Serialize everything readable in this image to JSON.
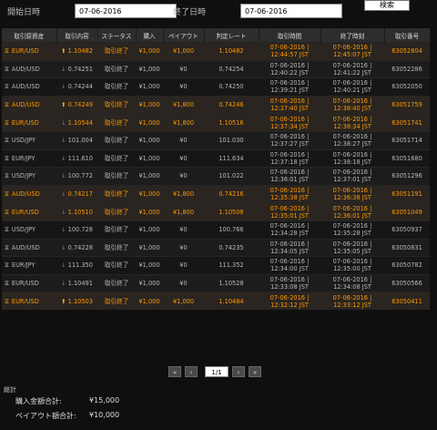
{
  "filter": {
    "start_label": "開始日時",
    "start_value": "07-06-2016",
    "end_label": "終了日時",
    "end_value": "07-06-2016",
    "search_label": "検索"
  },
  "table": {
    "headers": [
      "取引原資産",
      "取引内容",
      "ステータス",
      "購入",
      "ペイアウト",
      "判定レート",
      "取引時間",
      "終了時刻",
      "取引番号"
    ],
    "rows": [
      {
        "asset": "EUR/USD",
        "dir": "up",
        "rate": "1.10482",
        "status": "取引終了",
        "purchase": "¥1,000",
        "payout": "¥1,000",
        "judge": "1.10482",
        "time1": "07-06-2016 |",
        "time2": "12:44:57 JST",
        "end1": "07-06-2016 |",
        "end2": "12:45:07 JST",
        "id": "63052804",
        "result": "win"
      },
      {
        "asset": "AUD/USD",
        "dir": "down",
        "rate": "0.74251",
        "status": "取引終了",
        "purchase": "¥1,000",
        "payout": "¥0",
        "judge": "0.74254",
        "time1": "07-06-2016 |",
        "time2": "12:40:22 JST",
        "end1": "07-06-2016 |",
        "end2": "12:41:22 JST",
        "id": "63052286",
        "result": "lose"
      },
      {
        "asset": "AUD/USD",
        "dir": "down",
        "rate": "0.74244",
        "status": "取引終了",
        "purchase": "¥1,000",
        "payout": "¥0",
        "judge": "0.74250",
        "time1": "07-06-2016 |",
        "time2": "12:39:21 JST",
        "end1": "07-06-2016 |",
        "end2": "12:40:21 JST",
        "id": "63052050",
        "result": "lose"
      },
      {
        "asset": "AUD/USD",
        "dir": "up",
        "rate": "0.74249",
        "status": "取引終了",
        "purchase": "¥1,000",
        "payout": "¥1,800",
        "judge": "0.74246",
        "time1": "07-06-2016 |",
        "time2": "12:37:40 JST",
        "end1": "07-06-2016 |",
        "end2": "12:38:40 JST",
        "id": "63051759",
        "result": "win"
      },
      {
        "asset": "EUR/USD",
        "dir": "down",
        "rate": "1.10544",
        "status": "取引終了",
        "purchase": "¥1,000",
        "payout": "¥1,800",
        "judge": "1.10516",
        "time1": "07-06-2016 |",
        "time2": "12:37:34 JST",
        "end1": "07-06-2016 |",
        "end2": "12:38:34 JST",
        "id": "63051741",
        "result": "win"
      },
      {
        "asset": "USD/JPY",
        "dir": "down",
        "rate": "101.004",
        "status": "取引終了",
        "purchase": "¥1,000",
        "payout": "¥0",
        "judge": "101.030",
        "time1": "07-06-2016 |",
        "time2": "12:37:27 JST",
        "end1": "07-06-2016 |",
        "end2": "12:38:27 JST",
        "id": "63051714",
        "result": "lose"
      },
      {
        "asset": "EUR/JPY",
        "dir": "down",
        "rate": "111.610",
        "status": "取引終了",
        "purchase": "¥1,000",
        "payout": "¥0",
        "judge": "111.634",
        "time1": "07-06-2016 |",
        "time2": "12:37:18 JST",
        "end1": "07-06-2016 |",
        "end2": "12:38:18 JST",
        "id": "63051680",
        "result": "lose"
      },
      {
        "asset": "USD/JPY",
        "dir": "down",
        "rate": "100.772",
        "status": "取引終了",
        "purchase": "¥1,000",
        "payout": "¥0",
        "judge": "101.022",
        "time1": "07-06-2016 |",
        "time2": "12:36:01 JST",
        "end1": "07-06-2016 |",
        "end2": "12:37:01 JST",
        "id": "63051296",
        "result": "lose"
      },
      {
        "asset": "AUD/USD",
        "dir": "down",
        "rate": "0.74217",
        "status": "取引終了",
        "purchase": "¥1,000",
        "payout": "¥1,800",
        "judge": "0.74216",
        "time1": "07-06-2016 |",
        "time2": "12:35:38 JST",
        "end1": "07-06-2016 |",
        "end2": "12:36:38 JST",
        "id": "63051191",
        "result": "win"
      },
      {
        "asset": "EUR/USD",
        "dir": "down",
        "rate": "1.10510",
        "status": "取引終了",
        "purchase": "¥1,000",
        "payout": "¥1,800",
        "judge": "1.10508",
        "time1": "07-06-2016 |",
        "time2": "12:35:01 JST",
        "end1": "07-06-2016 |",
        "end2": "12:36:01 JST",
        "id": "63051049",
        "result": "win"
      },
      {
        "asset": "USD/JPY",
        "dir": "down",
        "rate": "100.728",
        "status": "取引終了",
        "purchase": "¥1,000",
        "payout": "¥0",
        "judge": "100.766",
        "time1": "07-06-2016 |",
        "time2": "12:34:28 JST",
        "end1": "07-06-2016 |",
        "end2": "12:35:28 JST",
        "id": "63050937",
        "result": "lose"
      },
      {
        "asset": "AUD/USD",
        "dir": "down",
        "rate": "0.74228",
        "status": "取引終了",
        "purchase": "¥1,000",
        "payout": "¥0",
        "judge": "0.74235",
        "time1": "07-06-2016 |",
        "time2": "12:34:05 JST",
        "end1": "07-06-2016 |",
        "end2": "12:35:05 JST",
        "id": "63050831",
        "result": "lose"
      },
      {
        "asset": "EUR/JPY",
        "dir": "down",
        "rate": "111.350",
        "status": "取引終了",
        "purchase": "¥1,000",
        "payout": "¥0",
        "judge": "111.352",
        "time1": "07-06-2016 |",
        "time2": "12:34:00 JST",
        "end1": "07-06-2016 |",
        "end2": "12:35:00 JST",
        "id": "63050782",
        "result": "lose"
      },
      {
        "asset": "EUR/USD",
        "dir": "down",
        "rate": "1.10491",
        "status": "取引終了",
        "purchase": "¥1,000",
        "payout": "¥0",
        "judge": "1.10528",
        "time1": "07-06-2016 |",
        "time2": "12:33:08 JST",
        "end1": "07-06-2016 |",
        "end2": "12:34:08 JST",
        "id": "63050566",
        "result": "lose"
      },
      {
        "asset": "EUR/USD",
        "dir": "up",
        "rate": "1.10503",
        "status": "取引終了",
        "purchase": "¥1,000",
        "payout": "¥1,000",
        "judge": "1.10484",
        "time1": "07-06-2016 |",
        "time2": "12:32:12 JST",
        "end1": "07-06-2016 |",
        "end2": "12:33:12 JST",
        "id": "63050411",
        "result": "win"
      }
    ]
  },
  "pagination": {
    "first_icon": "«",
    "prev_icon": "‹",
    "page": "1/1",
    "next_icon": "›",
    "last_icon": "»"
  },
  "summary": {
    "title": "総計",
    "purchase_label": "購入金額合計:",
    "purchase_value": "¥15,000",
    "payout_label": "ペイアウト額合計:",
    "payout_value": "¥10,000"
  },
  "colors": {
    "win_text": "#ff9800",
    "lose_text": "#b8b8b8",
    "header_bg": "#2d2d2d"
  },
  "icons": {
    "hourglass": "hourglass-icon",
    "up": "arrow-up-icon",
    "down": "arrow-down-icon"
  }
}
